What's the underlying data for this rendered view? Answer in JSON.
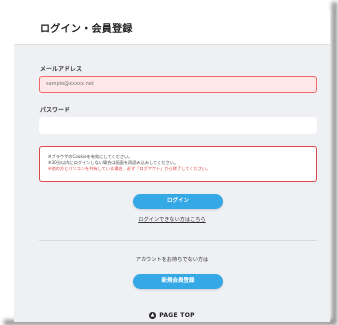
{
  "header": {
    "title": "ログイン・会員登録"
  },
  "email": {
    "label": "メールアドレス",
    "placeholder": "sample@xxxxx.net"
  },
  "password": {
    "label": "パスワード",
    "placeholder": ""
  },
  "notice": {
    "line1": "※ブラウザのCookieを有効にしてください。",
    "line2": "※30分以内にログインしない場合は画面を再読み込みしてください。",
    "line3": "※他の方とパソコンを共有している場合、必ず「ログアウト」から終了してください。"
  },
  "actions": {
    "login_label": "ログイン",
    "cant_login_link": "ログインできない方はこちら",
    "no_account_text": "アカウントをお持ちでない方は",
    "register_label": "新規会員登録"
  },
  "footer": {
    "pagetop_label": "PAGE TOP",
    "pagetop_icon": "chevron-up-icon"
  },
  "colors": {
    "accent": "#35a8e6",
    "error_border": "#ef6b6b",
    "error_bg": "#fde7e7",
    "warning_text": "#e03c3c"
  }
}
